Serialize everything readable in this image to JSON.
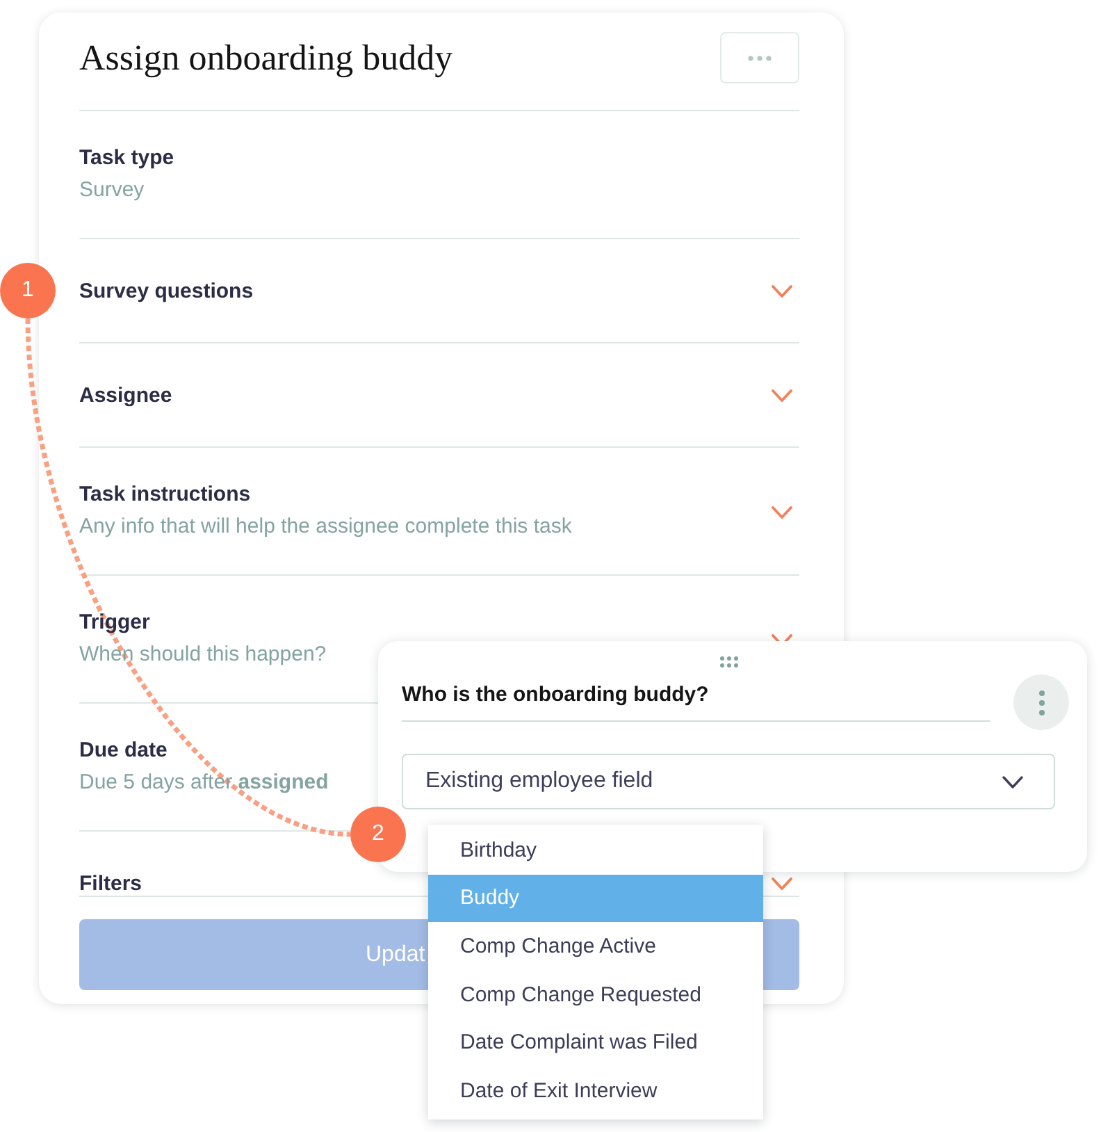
{
  "card": {
    "title": "Assign onboarding buddy",
    "sections": [
      {
        "kind": "static",
        "label": "Task type",
        "detail": "Survey"
      },
      {
        "kind": "collapsible",
        "label": "Survey questions"
      },
      {
        "kind": "collapsible",
        "label": "Assignee"
      },
      {
        "kind": "collapsible",
        "label": "Task instructions",
        "detail": "Any info that will help the assignee complete this task"
      },
      {
        "kind": "collapsible",
        "label": "Trigger",
        "detail": "When should this happen?"
      },
      {
        "kind": "static",
        "label": "Due date",
        "detail": "Due 5 days after **assigned**"
      },
      {
        "kind": "collapsible",
        "label": "Filters"
      }
    ],
    "submit_button": {
      "label": "Updat"
    }
  },
  "question_card": {
    "question": "Who is the onboarding buddy?",
    "answer_source": "Existing employee field",
    "options": [
      {
        "label": "Birthday",
        "selected": false
      },
      {
        "label": "Buddy",
        "selected": true
      },
      {
        "label": "Comp Change Active",
        "selected": false
      },
      {
        "label": "Comp Change Requested",
        "selected": false
      },
      {
        "label": "Date Complaint was Filed",
        "selected": false
      },
      {
        "label": "Date of Exit Interview",
        "selected": false
      }
    ]
  },
  "callouts": [
    {
      "number": "1"
    },
    {
      "number": "2"
    }
  ]
}
